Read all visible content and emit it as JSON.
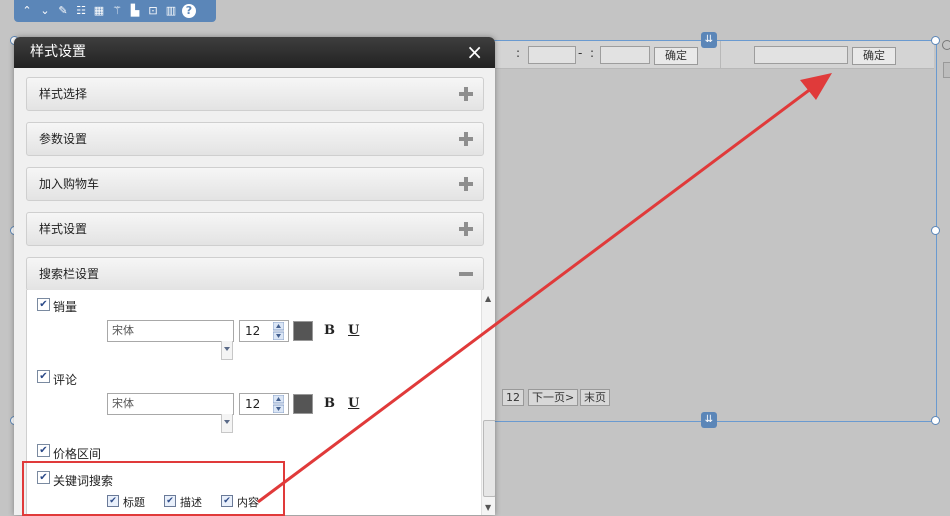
{
  "toolbar": {
    "icons": [
      "arrow-up-icon",
      "arrow-down-icon",
      "edit-icon",
      "list-icon",
      "grid-icon",
      "magic-wand-icon",
      "align-icon",
      "unlock-icon",
      "trash-icon",
      "help-icon"
    ],
    "color": "#5b86b8"
  },
  "background_widget": {
    "price_sep1": ":",
    "price_dash": "-",
    "price_sep2": ":",
    "confirm1": "确定",
    "confirm2": "确定",
    "page_num": "12",
    "next_page": "下一页>",
    "last_page": "末页"
  },
  "dialog": {
    "title": "样式设置",
    "close": "×",
    "panels": [
      {
        "label": "样式选择",
        "state": "collapsed"
      },
      {
        "label": "参数设置",
        "state": "collapsed"
      },
      {
        "label": "加入购物车",
        "state": "collapsed"
      },
      {
        "label": "样式设置",
        "state": "collapsed"
      },
      {
        "label": "搜索栏设置",
        "state": "expanded"
      }
    ],
    "search_settings": {
      "sales": {
        "label": "销量",
        "checked": true,
        "font": "宋体",
        "size": "12",
        "bold": "B",
        "underline": "U"
      },
      "review": {
        "label": "评论",
        "checked": true,
        "font": "宋体",
        "size": "12",
        "bold": "B",
        "underline": "U"
      },
      "price_range": {
        "label": "价格区间",
        "checked": true
      },
      "keyword_search": {
        "label": "关键词搜索",
        "checked": true,
        "options": [
          {
            "label": "标题",
            "checked": true
          },
          {
            "label": "描述",
            "checked": true
          },
          {
            "label": "内容",
            "checked": true
          }
        ]
      }
    }
  },
  "annotation_color": "#e03a3a"
}
